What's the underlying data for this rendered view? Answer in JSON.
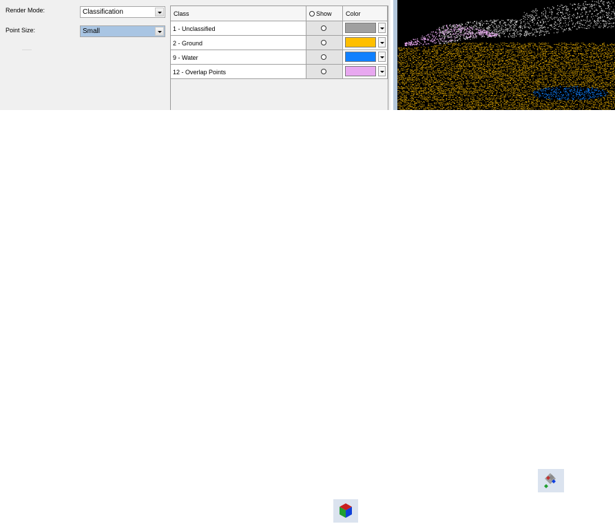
{
  "settings": {
    "render_mode_label": "Render Mode:",
    "render_mode_value": "Classification",
    "point_size_label": "Point Size:",
    "point_size_value": "Small"
  },
  "class_table": {
    "headers": {
      "class": "Class",
      "show": "Show",
      "color": "Color"
    },
    "rows": [
      {
        "class": "1 - Unclassified",
        "color": "#a0a0a0"
      },
      {
        "class": "2 - Ground",
        "color": "#ffbf00"
      },
      {
        "class": "9 - Water",
        "color": "#1080ff"
      },
      {
        "class": "12 - Overlap Points",
        "color": "#e8a8f0"
      }
    ]
  },
  "viewport": {
    "background": "#000000"
  },
  "toolbar_icons": [
    "points-display-icon",
    "color-cube-icon"
  ]
}
